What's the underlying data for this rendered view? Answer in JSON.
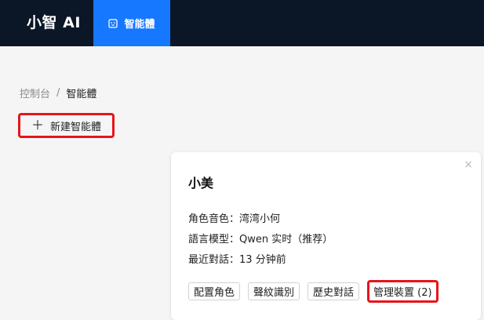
{
  "header": {
    "brand": "小智 AI",
    "nav": {
      "label": "智能體",
      "icon": "robot-icon",
      "active_color": "#1677ff"
    }
  },
  "breadcrumb": {
    "root": "控制台",
    "separator": "/",
    "current": "智能體"
  },
  "toolbar": {
    "new_agent_label": "新建智能體",
    "new_agent_icon": "plus-icon"
  },
  "card": {
    "title": "小美",
    "close_glyph": "×",
    "fields": {
      "voice_label": "角色音色：",
      "voice_value": "湾湾小何",
      "model_label": "語言模型：",
      "model_value": "Qwen 实时（推荐）",
      "recent_label": "最近對話：",
      "recent_value": "13 分钟前"
    },
    "actions": {
      "configure_role": "配置角色",
      "voiceprint": "聲紋識別",
      "history": "歷史對話",
      "manage_devices": "管理裝置 (2)"
    }
  },
  "colors": {
    "topbar_bg": "#0b1626",
    "highlight_border": "#e8141b",
    "page_bg": "#f5f5f6"
  }
}
